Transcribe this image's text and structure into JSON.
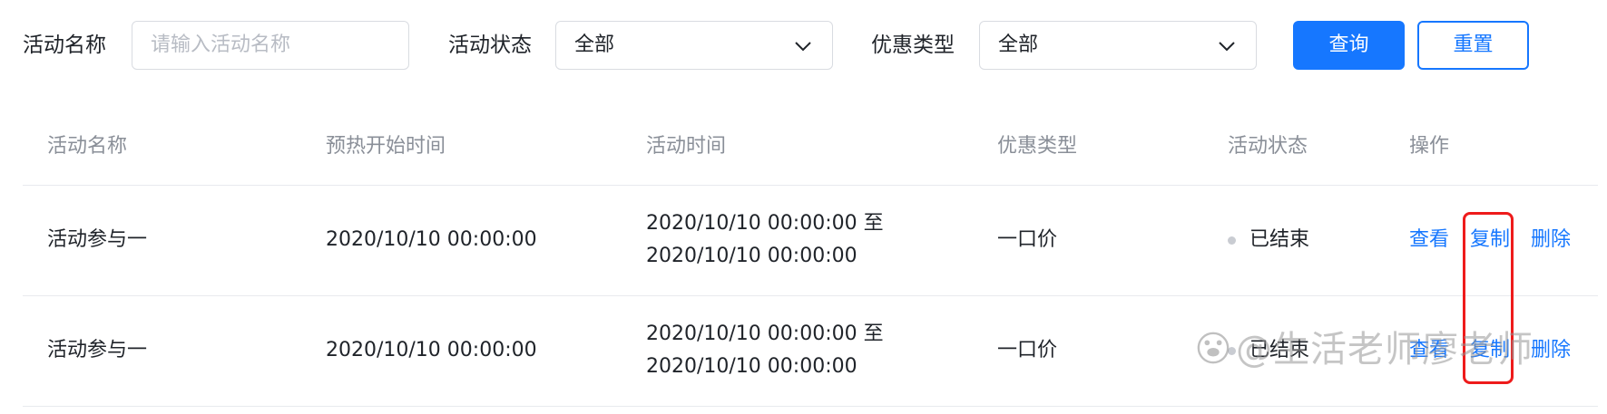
{
  "filters": {
    "name_label": "活动名称",
    "name_placeholder": "请输入活动名称",
    "status_label": "活动状态",
    "status_value": "全部",
    "discount_label": "优惠类型",
    "discount_value": "全部",
    "query_button": "查询",
    "reset_button": "重置"
  },
  "table": {
    "headers": [
      "活动名称",
      "预热开始时间",
      "活动时间",
      "优惠类型",
      "活动状态",
      "操作"
    ],
    "rows": [
      {
        "name": "活动参与一",
        "preheat_start": "2020/10/10 00:00:00",
        "time_line1": "2020/10/10 00:00:00 至",
        "time_line2": "2020/10/10 00:00:00",
        "discount": "一口价",
        "status": "已结束",
        "ops": [
          "查看",
          "复制",
          "删除"
        ]
      },
      {
        "name": "活动参与一",
        "preheat_start": "2020/10/10 00:00:00",
        "time_line1": "2020/10/10 00:00:00 至",
        "time_line2": "2020/10/10 00:00:00",
        "discount": "一口价",
        "status": "已结束",
        "ops": [
          "查看",
          "复制",
          "删除"
        ]
      }
    ]
  },
  "watermark": "@生活老师廖老师",
  "colors": {
    "primary": "#1677ff",
    "highlight": "#ee1b1b",
    "muted": "#8a8f98"
  }
}
